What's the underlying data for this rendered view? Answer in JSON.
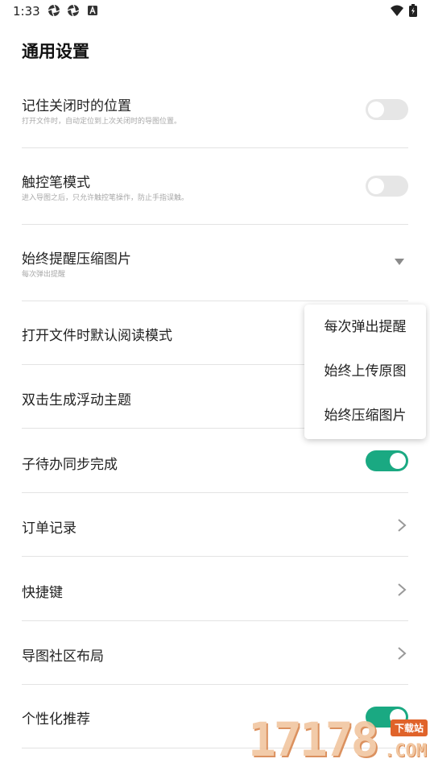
{
  "status_bar": {
    "time": "1:33",
    "left_icons": [
      "aperture-icon",
      "aperture-icon",
      "app-a-icon"
    ],
    "right_icons": [
      "wifi-icon",
      "battery-charging-icon"
    ]
  },
  "page": {
    "title": "通用设置"
  },
  "settings": [
    {
      "label": "记住关闭时的位置",
      "desc": "打开文件时，自动定位到上次关闭时的导图位置。",
      "control": "toggle",
      "on": false
    },
    {
      "label": "触控笔模式",
      "desc": "进入导图之后，只允许触控笔操作，防止手指误触。",
      "control": "toggle",
      "on": false
    },
    {
      "label": "始终提醒压缩图片",
      "desc": "每次弹出提醒",
      "control": "dropdown"
    },
    {
      "label": "打开文件时默认阅读模式",
      "control": "toggle-hidden"
    },
    {
      "label": "双击生成浮动主题",
      "control": "toggle-hidden"
    },
    {
      "label": "子待办同步完成",
      "control": "toggle",
      "on": true
    },
    {
      "label": "订单记录",
      "control": "chevron"
    },
    {
      "label": "快捷键",
      "control": "chevron"
    },
    {
      "label": "导图社区布局",
      "control": "chevron"
    },
    {
      "label": "个性化推荐",
      "control": "toggle",
      "on": true
    }
  ],
  "dropdown_menu": {
    "options": [
      "每次弹出提醒",
      "始终上传原图",
      "始终压缩图片"
    ]
  },
  "watermark": {
    "digits": "17178",
    "badge": "下载站",
    "suffix": ".COM"
  },
  "colors": {
    "accent": "#1aa982",
    "toggle_off": "#e6e6e6",
    "divider": "#e3e3e3"
  }
}
